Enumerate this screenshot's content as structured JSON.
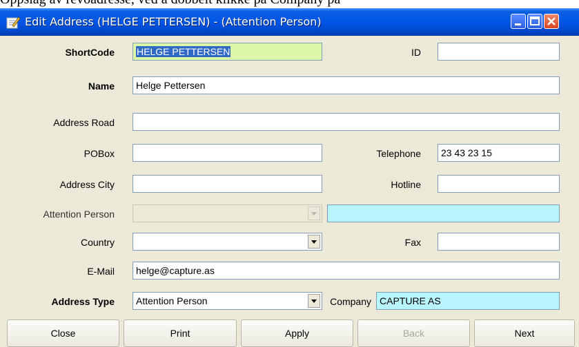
{
  "clipped_caption": "Oppslag av revoadresse, ved å dobbelt klikke på Company pa",
  "window": {
    "title": "Edit Address (HELGE PETTERSEN) -  (Attention Person)"
  },
  "form": {
    "shortcode": {
      "label": "ShortCode",
      "value": "HELGE PETTERSEN"
    },
    "id": {
      "label": "ID",
      "value": ""
    },
    "name": {
      "label": "Name",
      "value": "Helge Pettersen"
    },
    "address_road": {
      "label": "Address Road",
      "value": ""
    },
    "pobox": {
      "label": "POBox",
      "value": ""
    },
    "telephone": {
      "label": "Telephone",
      "value": "23 43 23 15"
    },
    "address_city": {
      "label": "Address City",
      "value": ""
    },
    "hotline": {
      "label": "Hotline",
      "value": ""
    },
    "attention_person": {
      "label": "Attention Person",
      "value": "",
      "extra": ""
    },
    "country": {
      "label": "Country",
      "value": ""
    },
    "fax": {
      "label": "Fax",
      "value": ""
    },
    "email": {
      "label": "E-Mail",
      "value": "helge@capture.as"
    },
    "address_type": {
      "label": "Address Type",
      "value": "Attention Person"
    },
    "company": {
      "label": "Company",
      "value": "CAPTURE AS"
    }
  },
  "buttons": {
    "close": "Close",
    "print": "Print",
    "apply": "Apply",
    "back": "Back",
    "next": "Next"
  },
  "colors": {
    "titlebar": "#0055e5",
    "highlight_field": "#dcf7a8",
    "cyan_field": "#b8f4fb",
    "selection": "#316ac5"
  }
}
